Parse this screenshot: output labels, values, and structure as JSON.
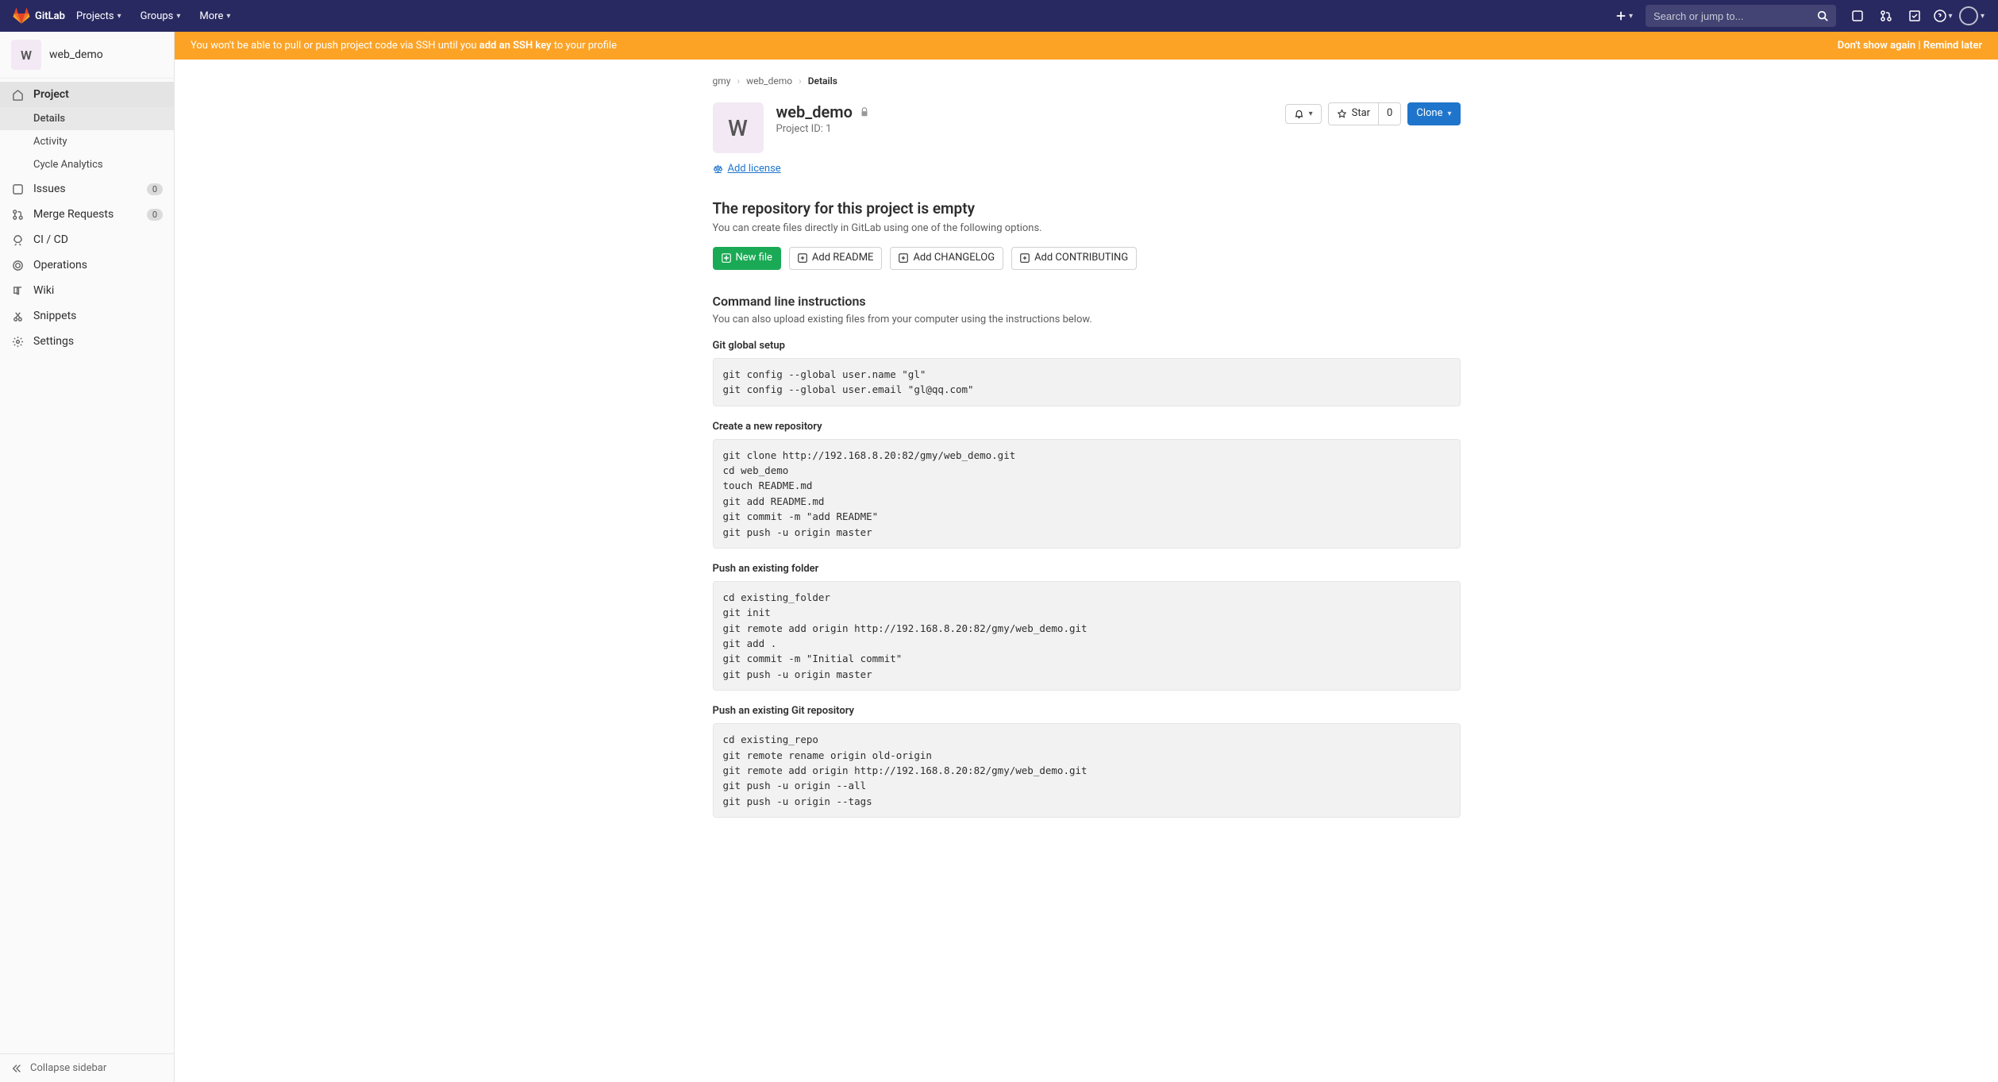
{
  "navbar": {
    "brand": "GitLab",
    "items": [
      "Projects",
      "Groups",
      "More"
    ],
    "search_placeholder": "Search or jump to..."
  },
  "sidebar": {
    "project_initial": "W",
    "project_name": "web_demo",
    "items": {
      "project": "Project",
      "details": "Details",
      "activity": "Activity",
      "cycle_analytics": "Cycle Analytics",
      "issues": "Issues",
      "merge_requests": "Merge Requests",
      "cicd": "CI / CD",
      "operations": "Operations",
      "wiki": "Wiki",
      "snippets": "Snippets",
      "settings": "Settings"
    },
    "badges": {
      "issues": "0",
      "mrs": "0"
    },
    "collapse": "Collapse sidebar"
  },
  "alert": {
    "prefix": "You won't be able to pull or push project code via SSH until you ",
    "link": "add an SSH key",
    "suffix": " to your profile",
    "dont_show": "Don't show again",
    "remind": "Remind later"
  },
  "breadcrumb": {
    "a": "gmy",
    "b": "web_demo",
    "c": "Details"
  },
  "project": {
    "initial": "W",
    "name": "web_demo",
    "id_label": "Project ID: 1",
    "star_label": "Star",
    "star_count": "0",
    "clone_label": "Clone",
    "add_license": "Add license"
  },
  "empty": {
    "title": "The repository for this project is empty",
    "desc": "You can create files directly in GitLab using one of the following options.",
    "new_file": "New file",
    "add_readme": "Add README",
    "add_changelog": "Add CHANGELOG",
    "add_contributing": "Add CONTRIBUTING"
  },
  "cli": {
    "title": "Command line instructions",
    "desc": "You can also upload existing files from your computer using the instructions below.",
    "global_setup_title": "Git global setup",
    "global_setup_code": "git config --global user.name \"gl\"\ngit config --global user.email \"gl@qq.com\"",
    "create_repo_title": "Create a new repository",
    "create_repo_code": "git clone http://192.168.8.20:82/gmy/web_demo.git\ncd web_demo\ntouch README.md\ngit add README.md\ngit commit -m \"add README\"\ngit push -u origin master",
    "push_folder_title": "Push an existing folder",
    "push_folder_code": "cd existing_folder\ngit init\ngit remote add origin http://192.168.8.20:82/gmy/web_demo.git\ngit add .\ngit commit -m \"Initial commit\"\ngit push -u origin master",
    "push_repo_title": "Push an existing Git repository",
    "push_repo_code": "cd existing_repo\ngit remote rename origin old-origin\ngit remote add origin http://192.168.8.20:82/gmy/web_demo.git\ngit push -u origin --all\ngit push -u origin --tags"
  }
}
